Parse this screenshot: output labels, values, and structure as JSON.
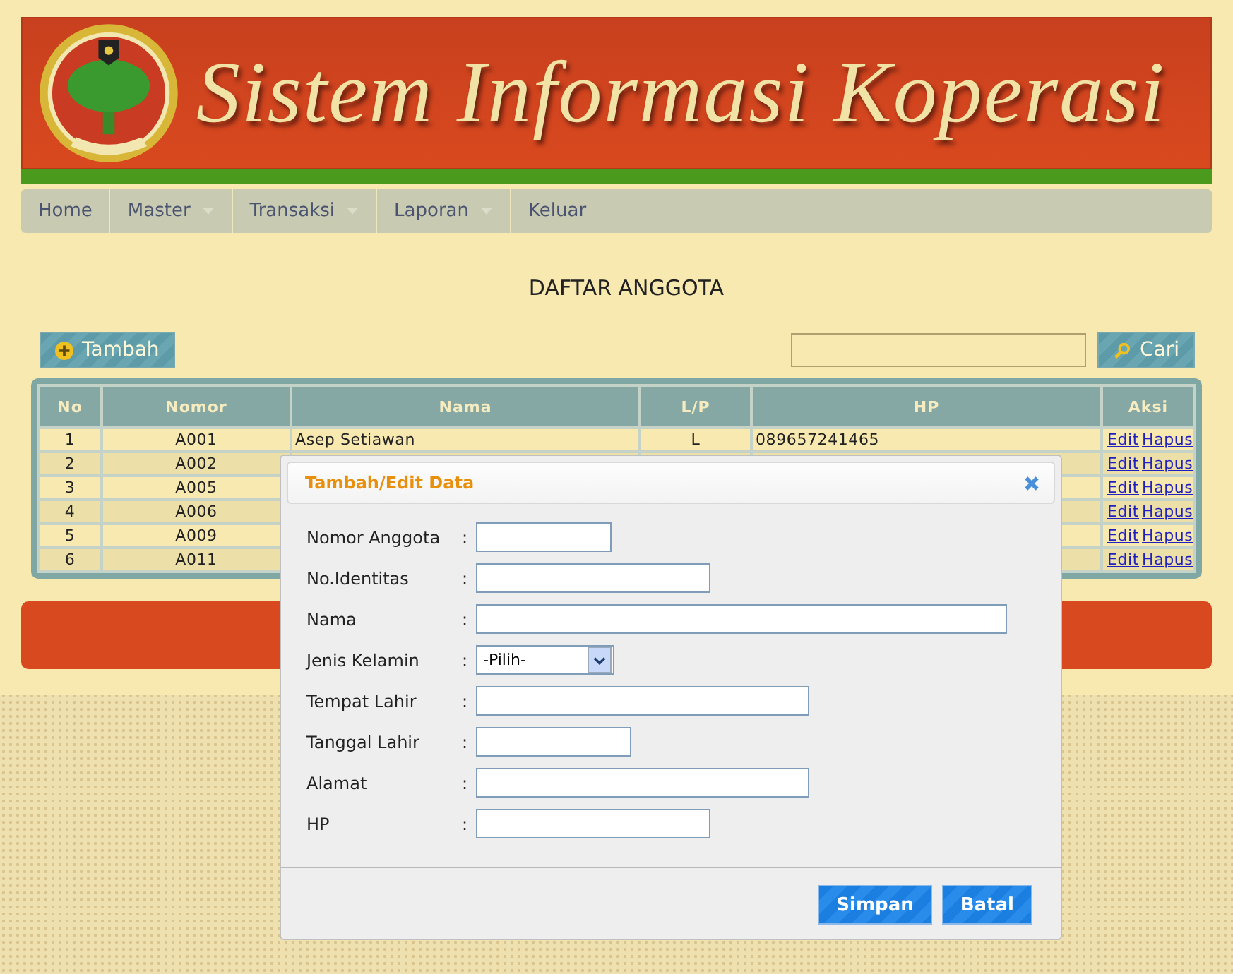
{
  "header": {
    "title": "Sistem Informasi Koperasi"
  },
  "nav": [
    {
      "label": "Home",
      "dropdown": false
    },
    {
      "label": "Master",
      "dropdown": true
    },
    {
      "label": "Transaksi",
      "dropdown": true
    },
    {
      "label": "Laporan",
      "dropdown": true
    },
    {
      "label": "Keluar",
      "dropdown": false
    }
  ],
  "page_title": "DAFTAR ANGGOTA",
  "add_button": "Tambah",
  "search": {
    "button": "Cari"
  },
  "table": {
    "columns": [
      "No",
      "Nomor",
      "Nama",
      "L/P",
      "HP",
      "Aksi"
    ],
    "rows": [
      {
        "no": "1",
        "nomor": "A001",
        "nama": "Asep Setiawan",
        "lp": "L",
        "hp": "089657241465",
        "actions": [
          "Edit",
          "Hapus"
        ]
      },
      {
        "no": "2",
        "nomor": "A002",
        "actions": [
          "Edit",
          "Hapus"
        ]
      },
      {
        "no": "3",
        "nomor": "A005",
        "actions": [
          "Edit",
          "Hapus"
        ]
      },
      {
        "no": "4",
        "nomor": "A006",
        "actions": [
          "Edit",
          "Hapus"
        ]
      },
      {
        "no": "5",
        "nomor": "A009",
        "actions": [
          "Edit",
          "Hapus"
        ]
      },
      {
        "no": "6",
        "nomor": "A011",
        "actions": [
          "Edit",
          "Hapus"
        ]
      }
    ]
  },
  "dialog": {
    "title": "Tambah/Edit Data",
    "fields": [
      {
        "label": "Nomor Anggota",
        "separator": ":",
        "kind": "input"
      },
      {
        "label": "No.Identitas",
        "separator": ":",
        "kind": "input"
      },
      {
        "label": "Nama",
        "separator": ":",
        "kind": "input"
      },
      {
        "label": "Jenis Kelamin",
        "separator": ":",
        "kind": "select",
        "value": "-Pilih-"
      },
      {
        "label": "Tempat Lahir",
        "separator": ":",
        "kind": "input"
      },
      {
        "label": "Tanggal Lahir",
        "separator": ":",
        "kind": "input"
      },
      {
        "label": "Alamat",
        "separator": ":",
        "kind": "input"
      },
      {
        "label": "HP",
        "separator": ":",
        "kind": "input"
      }
    ],
    "buttons": [
      "Simpan",
      "Batal"
    ]
  }
}
